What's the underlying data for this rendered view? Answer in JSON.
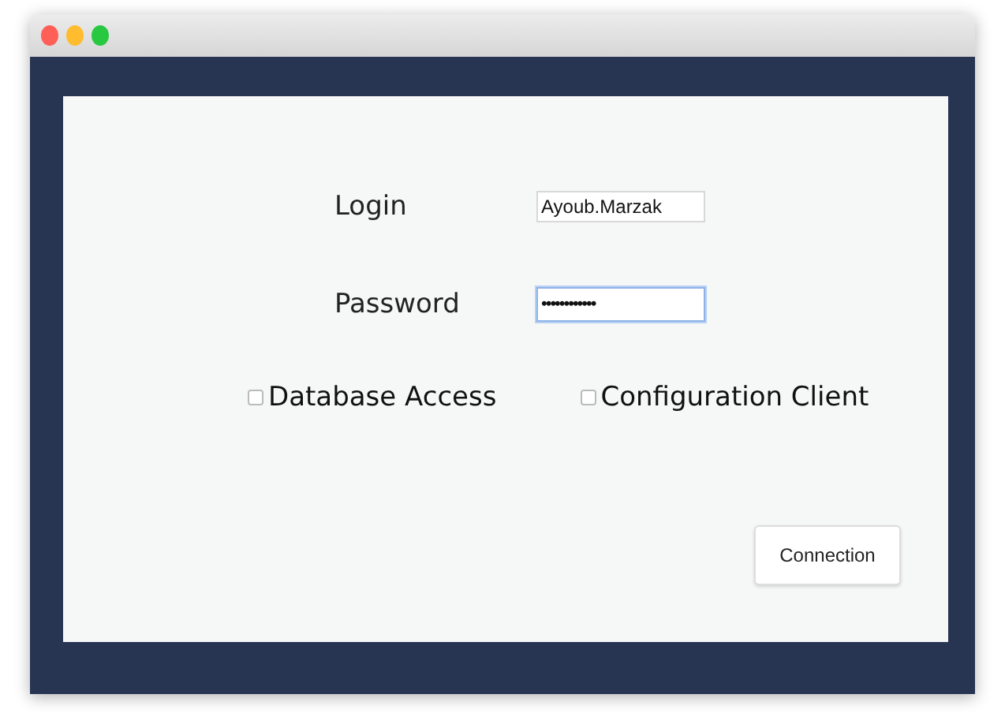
{
  "window": {
    "controls": [
      {
        "color": "#fe5f57"
      },
      {
        "color": "#febc2e"
      },
      {
        "color": "#28c840"
      }
    ]
  },
  "fields": [
    {
      "label": "Login",
      "kind": "text",
      "value": "Ayoub.Marzak",
      "focused": false
    },
    {
      "label": "Password",
      "kind": "password",
      "value": "••••••••••••",
      "focused": true
    }
  ],
  "checkboxes": [
    {
      "label": "Database Access",
      "checked": false
    },
    {
      "label": "Configuration Client",
      "checked": false
    }
  ],
  "button": {
    "label": "Connection"
  }
}
